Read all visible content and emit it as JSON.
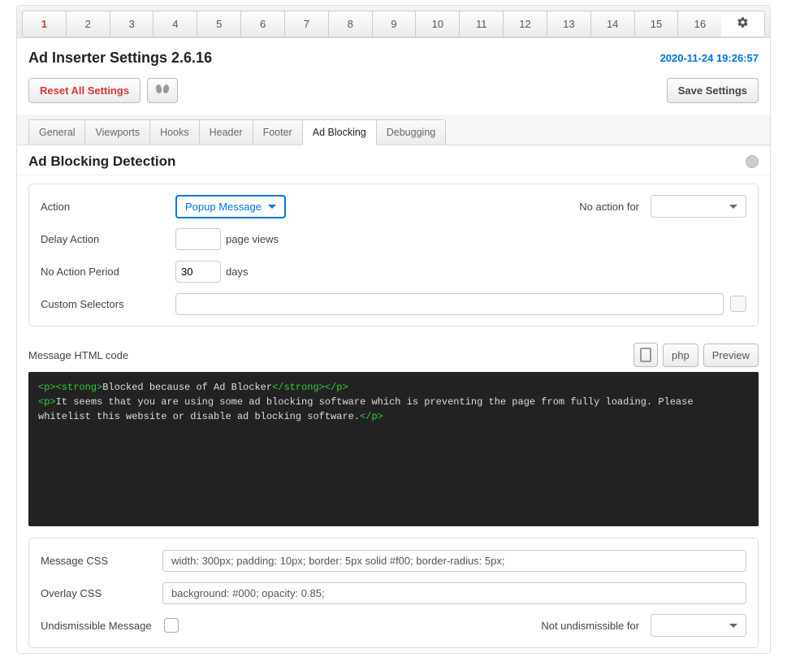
{
  "top_tabs": [
    "1",
    "2",
    "3",
    "4",
    "5",
    "6",
    "7",
    "8",
    "9",
    "10",
    "11",
    "12",
    "13",
    "14",
    "15",
    "16"
  ],
  "active_top_tab": "1",
  "title": "Ad Inserter Settings 2.6.16",
  "datetime": "2020-11-24 19:26:57",
  "reset_label": "Reset All Settings",
  "save_label": "Save Settings",
  "sub_tabs": [
    "General",
    "Viewports",
    "Hooks",
    "Header",
    "Footer",
    "Ad Blocking",
    "Debugging"
  ],
  "active_sub_tab": "Ad Blocking",
  "section_title": "Ad Blocking Detection",
  "form": {
    "action_label": "Action",
    "action_value": "Popup Message",
    "no_action_for_label": "No action for",
    "no_action_for_value": "",
    "delay_label": "Delay Action",
    "delay_value": "",
    "delay_units": "page views",
    "period_label": "No Action Period",
    "period_value": "30",
    "period_units": "days",
    "selectors_label": "Custom Selectors",
    "selectors_value": ""
  },
  "msg": {
    "label": "Message HTML code",
    "php_label": "php",
    "preview_label": "Preview",
    "tag1_open": "<p><strong>",
    "text1": "Blocked because of Ad Blocker",
    "tag1_close": "</strong></p>",
    "tag2_open": "<p>",
    "text2": "It seems that you are using some ad blocking software which is preventing the page from fully loading. Please whitelist this website or disable ad blocking software.",
    "tag2_close": "</p>"
  },
  "css": {
    "message_label": "Message CSS",
    "message_value": "width: 300px; padding: 10px; border: 5px solid #f00; border-radius: 5px;",
    "overlay_label": "Overlay CSS",
    "overlay_value": "background: #000; opacity: 0.85;",
    "undismissible_label": "Undismissible Message",
    "not_undismissible_label": "Not undismissible for",
    "not_undismissible_value": ""
  }
}
